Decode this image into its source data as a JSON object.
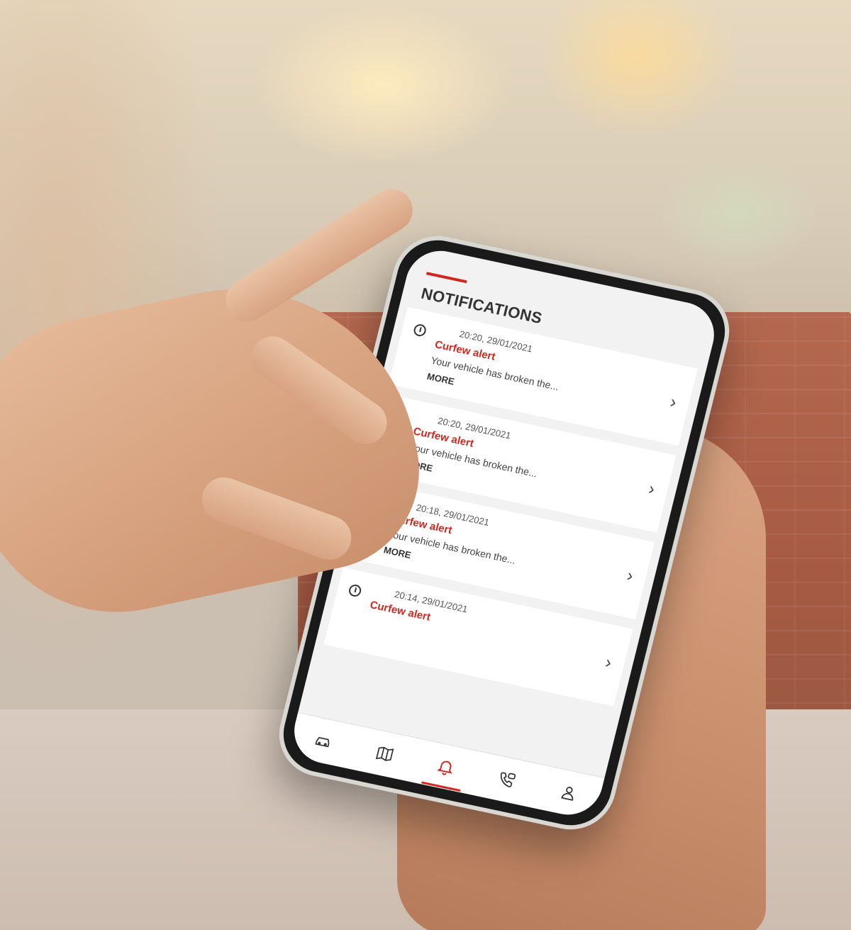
{
  "screen": {
    "title": "NOTIFICATIONS",
    "notifications": [
      {
        "time": "20:20, 29/01/2021",
        "type": "Curfew alert",
        "message": "Your vehicle has broken the...",
        "more": "MORE"
      },
      {
        "time": "20:20, 29/01/2021",
        "type": "Curfew alert",
        "message": "Your vehicle has broken the...",
        "more": "MORE"
      },
      {
        "time": "20:18, 29/01/2021",
        "type": "Curfew alert",
        "message": "Your vehicle has broken the...",
        "more": "MORE"
      },
      {
        "time": "20:14, 29/01/2021",
        "type": "Curfew alert",
        "message": "",
        "more": ""
      }
    ],
    "tabbar": {
      "items": [
        {
          "icon": "car-icon"
        },
        {
          "icon": "map-icon"
        },
        {
          "icon": "bell-icon",
          "active": true
        },
        {
          "icon": "support-phone-icon"
        },
        {
          "icon": "profile-icon"
        }
      ]
    }
  },
  "colors": {
    "accent": "#d0281f",
    "card_bg": "#ffffff",
    "screen_bg": "#f2f2f2"
  }
}
